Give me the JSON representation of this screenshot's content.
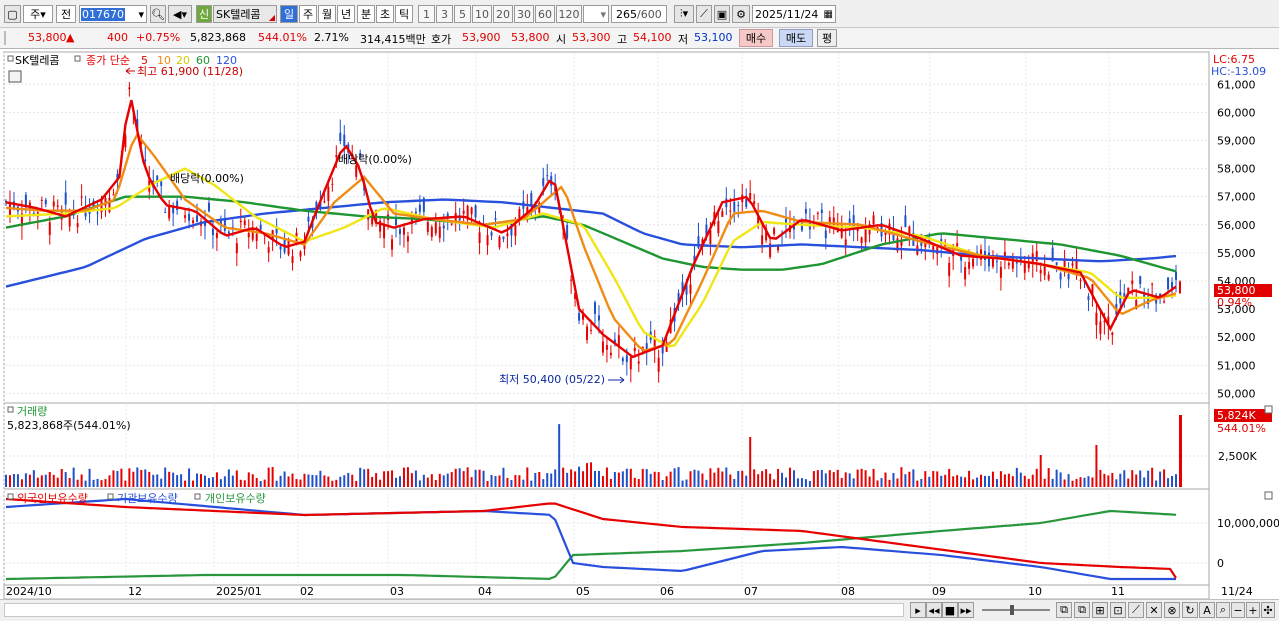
{
  "toolbar": {
    "code_type": "주",
    "scope": "전",
    "code": "017670",
    "stock_badge": "신",
    "stock_name": "SK텔레콤",
    "periods": [
      "일",
      "주",
      "월",
      "년",
      "분",
      "초",
      "틱"
    ],
    "active_period": "일",
    "intervals": [
      "1",
      "3",
      "5",
      "10",
      "20",
      "30",
      "60",
      "120"
    ],
    "count": "265",
    "count_max": "/600",
    "date": "2025/11/24"
  },
  "info": {
    "price": "53,800",
    "arrow": "▲",
    "change": "400",
    "change_pct": "+0.75%",
    "volume": "5,823,868",
    "volume_pct": "544.01%",
    "turnover": "2.71%",
    "amount": "314,415백만",
    "quote_label": "호가",
    "ask": "53,900",
    "bid": "53,800",
    "open_label": "시",
    "open": "53,300",
    "high_label": "고",
    "high": "54,100",
    "low_label": "저",
    "low": "53,100",
    "buy_btn": "매수",
    "sell_btn": "매도",
    "eval_btn": "평"
  },
  "price_panel": {
    "legend_name": "SK텔레콤",
    "legend_close": "종가 단순",
    "ma_periods": [
      "5",
      "10",
      "20",
      "60",
      "120"
    ],
    "lc": "LC:6.75",
    "hc": "HC:-13.09",
    "high_annot": "최고 61,900 (11/28)",
    "low_annot": "최저 50,400 (05/22)",
    "div1": "배당락(0.00%)",
    "div2": "배당락(0.00%)",
    "current_price": "53,800",
    "current_pct": "0.94%",
    "yticks": [
      "61,000",
      "60,000",
      "59,000",
      "58,000",
      "57,000",
      "56,000",
      "55,000",
      "54,000",
      "53,000",
      "52,000",
      "51,000",
      "50,000"
    ]
  },
  "volume_panel": {
    "title": "거래량",
    "value": "5,823,868주(544.01%)",
    "current": "5,824K",
    "current_pct": "544.01%",
    "ytick": "2,500K"
  },
  "holding_panel": {
    "legends": [
      "외국인보유수량",
      "기관보유수량",
      "개인보유수량"
    ],
    "yticks": [
      "10,000,000",
      "0"
    ]
  },
  "xaxis": {
    "labels": [
      "2024/10",
      "12",
      "2025/01",
      "02",
      "03",
      "04",
      "05",
      "06",
      "07",
      "08",
      "09",
      "10",
      "11"
    ],
    "right_label": "11/24"
  },
  "colors": {
    "up": "#e60000",
    "down": "#1e50c8",
    "ma5": "#e60000",
    "ma10": "#f08c14",
    "ma20": "#f0e614",
    "ma60": "#1e9632",
    "ma120": "#2850dc",
    "foreign": "#e60000",
    "institution": "#2850dc",
    "individual": "#28963c"
  },
  "chart_data": {
    "type": "candlestick",
    "title": "SK텔레콤",
    "x_range": [
      "2024/10",
      "2025/11/24"
    ],
    "ylim": [
      49800,
      61900
    ],
    "ma": {
      "ma5": [
        [
          0,
          56800
        ],
        [
          15,
          56600
        ],
        [
          30,
          56300
        ],
        [
          48,
          56900
        ],
        [
          57,
          57700
        ],
        [
          62,
          60800
        ],
        [
          70,
          57900
        ],
        [
          80,
          56700
        ],
        [
          95,
          56500
        ],
        [
          110,
          55600
        ],
        [
          125,
          55900
        ],
        [
          140,
          55200
        ],
        [
          150,
          55400
        ],
        [
          160,
          57200
        ],
        [
          170,
          58900
        ],
        [
          178,
          58000
        ],
        [
          185,
          56100
        ],
        [
          195,
          55900
        ],
        [
          210,
          56200
        ],
        [
          230,
          56300
        ],
        [
          250,
          55700
        ],
        [
          265,
          56600
        ],
        [
          275,
          57800
        ],
        [
          288,
          53000
        ],
        [
          300,
          52100
        ],
        [
          315,
          51300
        ],
        [
          330,
          51700
        ],
        [
          345,
          54500
        ],
        [
          360,
          56800
        ],
        [
          373,
          57000
        ],
        [
          385,
          55400
        ],
        [
          400,
          56200
        ],
        [
          420,
          55800
        ],
        [
          440,
          56000
        ],
        [
          460,
          55500
        ],
        [
          480,
          54900
        ],
        [
          500,
          54800
        ],
        [
          520,
          54600
        ],
        [
          540,
          54300
        ],
        [
          555,
          52300
        ],
        [
          565,
          53700
        ],
        [
          580,
          53400
        ],
        [
          590,
          53900
        ]
      ],
      "ma10": [
        [
          0,
          56600
        ],
        [
          20,
          56500
        ],
        [
          40,
          56500
        ],
        [
          55,
          56900
        ],
        [
          65,
          59300
        ],
        [
          75,
          58400
        ],
        [
          90,
          56900
        ],
        [
          110,
          55900
        ],
        [
          130,
          55700
        ],
        [
          150,
          55300
        ],
        [
          165,
          56800
        ],
        [
          180,
          57700
        ],
        [
          195,
          56400
        ],
        [
          215,
          56200
        ],
        [
          240,
          56000
        ],
        [
          260,
          56200
        ],
        [
          280,
          57400
        ],
        [
          290,
          55300
        ],
        [
          305,
          52700
        ],
        [
          320,
          51500
        ],
        [
          335,
          51800
        ],
        [
          350,
          54000
        ],
        [
          365,
          56400
        ],
        [
          380,
          56500
        ],
        [
          400,
          56100
        ],
        [
          430,
          56000
        ],
        [
          460,
          55400
        ],
        [
          490,
          54900
        ],
        [
          520,
          54600
        ],
        [
          545,
          54100
        ],
        [
          560,
          52800
        ],
        [
          575,
          53300
        ],
        [
          590,
          53600
        ]
      ],
      "ma20": [
        [
          0,
          56300
        ],
        [
          30,
          56400
        ],
        [
          55,
          56600
        ],
        [
          75,
          57500
        ],
        [
          90,
          58000
        ],
        [
          105,
          57400
        ],
        [
          125,
          56300
        ],
        [
          150,
          55400
        ],
        [
          170,
          55900
        ],
        [
          190,
          56600
        ],
        [
          215,
          56200
        ],
        [
          245,
          55900
        ],
        [
          270,
          56400
        ],
        [
          290,
          56000
        ],
        [
          305,
          54200
        ],
        [
          320,
          52200
        ],
        [
          335,
          51600
        ],
        [
          350,
          53200
        ],
        [
          365,
          55400
        ],
        [
          380,
          56100
        ],
        [
          400,
          56000
        ],
        [
          430,
          55900
        ],
        [
          460,
          55600
        ],
        [
          490,
          54900
        ],
        [
          520,
          54600
        ],
        [
          545,
          54300
        ],
        [
          560,
          53400
        ],
        [
          575,
          53400
        ],
        [
          590,
          53500
        ]
      ],
      "ma60": [
        [
          0,
          55900
        ],
        [
          30,
          56300
        ],
        [
          60,
          57000
        ],
        [
          90,
          57000
        ],
        [
          120,
          56800
        ],
        [
          150,
          56500
        ],
        [
          180,
          56300
        ],
        [
          210,
          56200
        ],
        [
          240,
          56000
        ],
        [
          270,
          56300
        ],
        [
          290,
          56000
        ],
        [
          310,
          55400
        ],
        [
          330,
          54800
        ],
        [
          350,
          54500
        ],
        [
          370,
          54400
        ],
        [
          390,
          54400
        ],
        [
          410,
          54600
        ],
        [
          440,
          55300
        ],
        [
          470,
          55700
        ],
        [
          500,
          55500
        ],
        [
          530,
          55300
        ],
        [
          560,
          54900
        ],
        [
          590,
          54300
        ]
      ],
      "ma120": [
        [
          0,
          53800
        ],
        [
          40,
          54500
        ],
        [
          70,
          55500
        ],
        [
          100,
          56100
        ],
        [
          130,
          56400
        ],
        [
          160,
          56600
        ],
        [
          190,
          56800
        ],
        [
          220,
          56900
        ],
        [
          250,
          56800
        ],
        [
          275,
          56600
        ],
        [
          300,
          56400
        ],
        [
          320,
          55700
        ],
        [
          340,
          55300
        ],
        [
          370,
          55200
        ],
        [
          400,
          55300
        ],
        [
          430,
          55200
        ],
        [
          460,
          55100
        ],
        [
          490,
          54900
        ],
        [
          520,
          54800
        ],
        [
          550,
          54700
        ],
        [
          575,
          54800
        ],
        [
          590,
          54900
        ]
      ]
    },
    "volume_note": "daily volume bars, last bar 5,823,868",
    "holdings": {
      "foreign": [
        [
          0,
          16
        ],
        [
          60,
          14
        ],
        [
          150,
          12
        ],
        [
          240,
          13
        ],
        [
          275,
          15
        ],
        [
          300,
          11
        ],
        [
          340,
          9
        ],
        [
          400,
          8
        ],
        [
          460,
          4
        ],
        [
          520,
          0
        ],
        [
          560,
          -1
        ],
        [
          586,
          -1.5
        ],
        [
          590,
          -6
        ]
      ],
      "institution": [
        [
          0,
          14
        ],
        [
          60,
          16
        ],
        [
          150,
          12
        ],
        [
          240,
          13
        ],
        [
          275,
          12
        ],
        [
          285,
          0
        ],
        [
          300,
          -1
        ],
        [
          340,
          -2
        ],
        [
          380,
          3
        ],
        [
          420,
          4
        ],
        [
          470,
          2
        ],
        [
          520,
          -1
        ],
        [
          555,
          -4
        ],
        [
          590,
          -4
        ]
      ],
      "individual": [
        [
          0,
          -4
        ],
        [
          100,
          -3
        ],
        [
          200,
          -3
        ],
        [
          275,
          -4
        ],
        [
          285,
          2
        ],
        [
          340,
          3
        ],
        [
          400,
          5
        ],
        [
          470,
          8
        ],
        [
          520,
          10
        ],
        [
          555,
          13
        ],
        [
          590,
          12
        ]
      ]
    }
  }
}
